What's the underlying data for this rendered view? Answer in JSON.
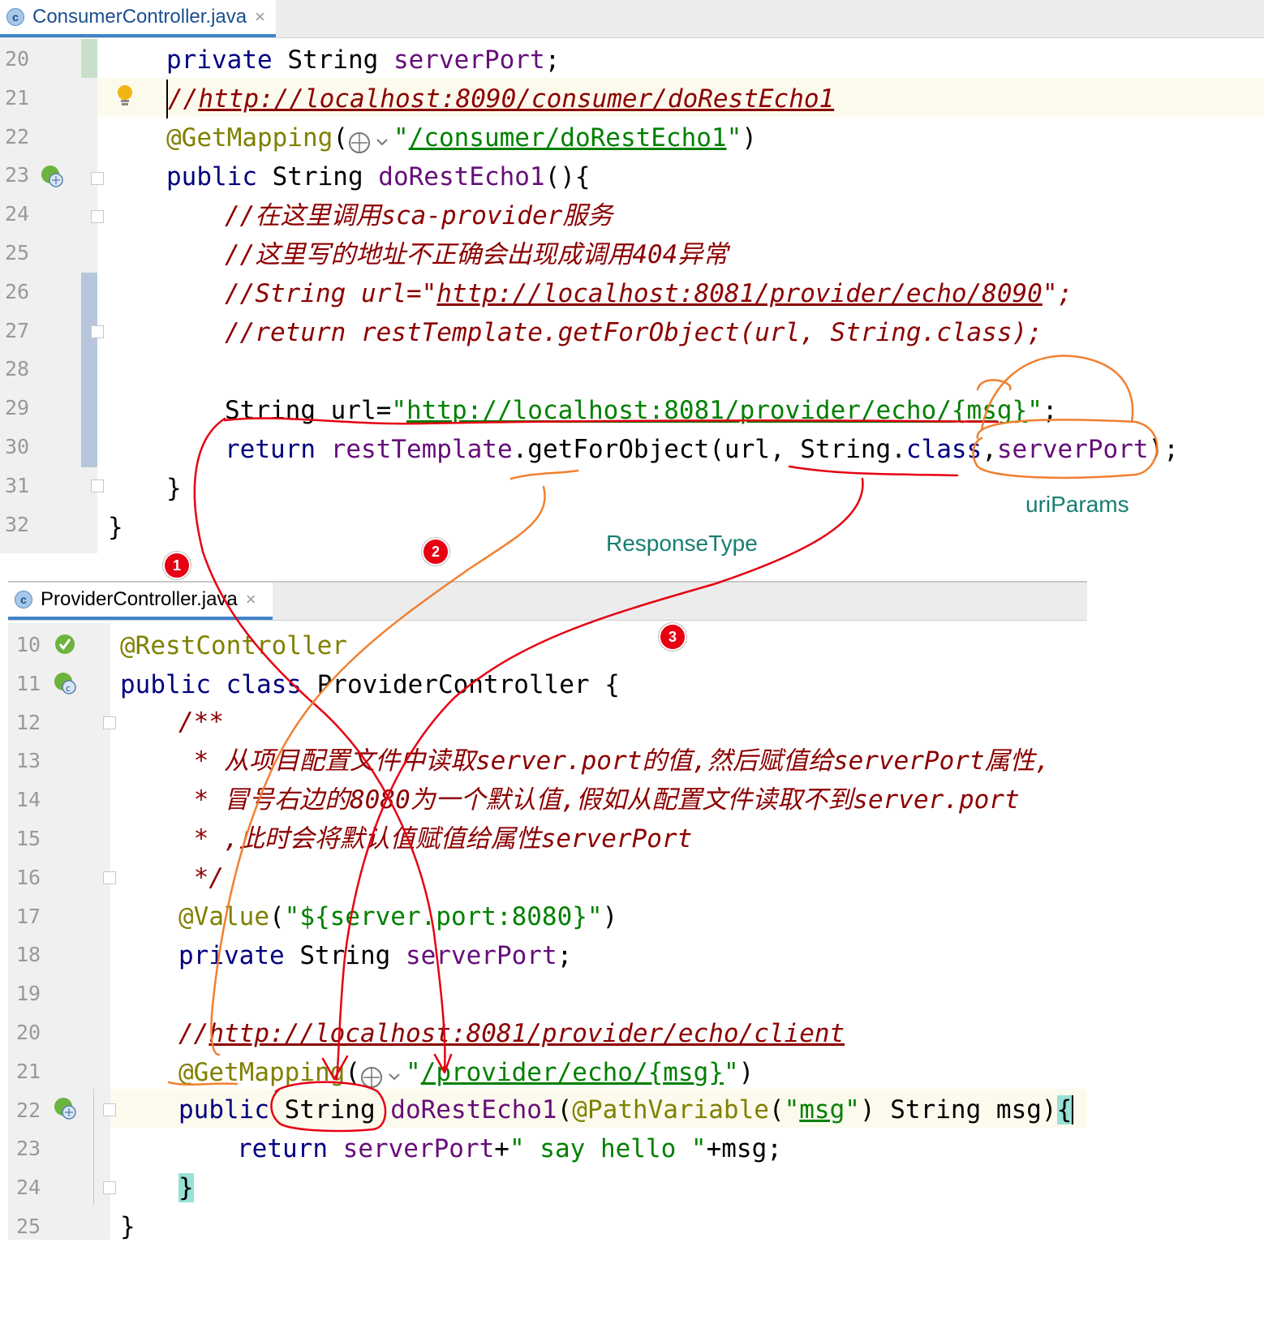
{
  "top_editor": {
    "tab": {
      "label": "ConsumerController.java",
      "icon_letter": "c",
      "close": "×"
    },
    "lines": [
      {
        "num": "20",
        "html_key": "l20"
      },
      {
        "num": "21",
        "html_key": "l21"
      },
      {
        "num": "22",
        "html_key": "l22"
      },
      {
        "num": "23",
        "html_key": "l23"
      },
      {
        "num": "24",
        "html_key": "l24"
      },
      {
        "num": "25",
        "html_key": "l25"
      },
      {
        "num": "26",
        "html_key": "l26"
      },
      {
        "num": "27",
        "html_key": "l27"
      },
      {
        "num": "28",
        "html_key": "l28"
      },
      {
        "num": "29",
        "html_key": "l29"
      },
      {
        "num": "30",
        "html_key": "l30"
      },
      {
        "num": "31",
        "html_key": "l31"
      },
      {
        "num": "32",
        "html_key": "l32"
      }
    ],
    "code": {
      "l20": [
        "private",
        " String ",
        "serverPort",
        ";"
      ],
      "l21": [
        "//",
        "http://localhost:8090/consumer/doRestEcho1"
      ],
      "l22": [
        "@GetMapping",
        "(",
        "\"",
        "/consumer/doRestEcho1",
        "\"",
        ")"
      ],
      "l23": [
        "public",
        " String ",
        "doRestEcho1",
        "(){"
      ],
      "l24": [
        "//在这里调用sca-provider服务"
      ],
      "l25": [
        "//这里写的地址不正确会出现成调用404异常"
      ],
      "l26": [
        "//String url=\"",
        "http://localhost:8081/provider/echo/8090",
        "\";"
      ],
      "l27": [
        "//return restTemplate.getForObject(url, String.class);"
      ],
      "l28": [
        ""
      ],
      "l29": [
        "String url=",
        "\"",
        "http://localhost:8081/provider/echo/{msg}",
        "\"",
        ";"
      ],
      "l30": [
        "return ",
        "restTemplate",
        ".getForObject(url, String.",
        "class",
        ",",
        "serverPort",
        ");"
      ],
      "l31": [
        "}"
      ],
      "l32": [
        "}"
      ]
    }
  },
  "bottom_editor": {
    "tab": {
      "label": "ProviderController.java",
      "icon_letter": "c",
      "close": "×"
    },
    "lines": [
      {
        "num": "10"
      },
      {
        "num": "11"
      },
      {
        "num": "12"
      },
      {
        "num": "13"
      },
      {
        "num": "14"
      },
      {
        "num": "15"
      },
      {
        "num": "16"
      },
      {
        "num": "17"
      },
      {
        "num": "18"
      },
      {
        "num": "19"
      },
      {
        "num": "20"
      },
      {
        "num": "21"
      },
      {
        "num": "22"
      },
      {
        "num": "23"
      },
      {
        "num": "24"
      },
      {
        "num": "25"
      }
    ],
    "code": {
      "l10": [
        "@RestController"
      ],
      "l11": [
        "public class ",
        "ProviderController {"
      ],
      "l12": [
        "/**"
      ],
      "l13": [
        " * 从项目配置文件中读取server.port的值,然后赋值给serverPort属性,"
      ],
      "l14": [
        " * 冒号右边的8080为一个默认值,假如从配置文件读取不到server.port"
      ],
      "l15": [
        " * ,此时会将默认值赋值给属性serverPort"
      ],
      "l16": [
        " */"
      ],
      "l17": [
        "@Value",
        "(",
        "\"${server.port:8080}\"",
        ")"
      ],
      "l18": [
        "private",
        " String ",
        "serverPort",
        ";"
      ],
      "l19": [
        ""
      ],
      "l20": [
        "//",
        "http://localhost:8081/provider/echo/client"
      ],
      "l21": [
        "@GetMapping",
        "(",
        "\"",
        "/provider/echo/{msg}",
        "\"",
        ")"
      ],
      "l22": [
        "public",
        " String ",
        "doRestEcho1",
        "(",
        "@PathVariable",
        "(",
        "\"",
        "msg",
        "\"",
        ") String msg)",
        "{"
      ],
      "l23": [
        "return ",
        "serverPort",
        "+",
        "\" say hello \"",
        "+msg;"
      ],
      "l24": [
        "}"
      ],
      "l25": [
        "}"
      ]
    }
  },
  "annotations": {
    "uriParams": "uriParams",
    "responseType": "ResponseType",
    "badges": [
      "1",
      "2",
      "3"
    ]
  },
  "colors": {
    "keyword": "#000080",
    "field": "#660e7a",
    "annotation": "#808000",
    "string": "#008000",
    "comment": "#8c0000",
    "label": "#167e72",
    "red_ink": "#e60012",
    "orange_ink": "#f08030"
  }
}
